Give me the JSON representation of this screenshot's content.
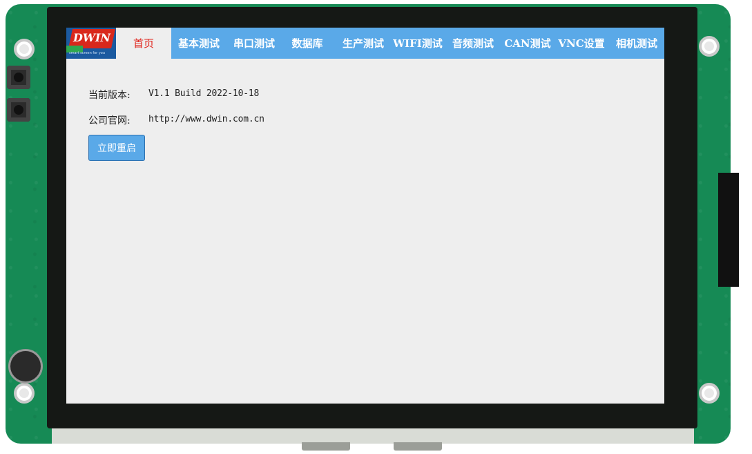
{
  "logo": {
    "text": "DWIN",
    "slogan": "smart screen for you"
  },
  "nav": {
    "tabs": [
      {
        "label": "首页"
      },
      {
        "label": "基本测试"
      },
      {
        "label": "串口测试"
      },
      {
        "label": "数据库"
      },
      {
        "label": "生产测试"
      },
      {
        "label": "WIFI测试"
      },
      {
        "label": "音频测试"
      },
      {
        "label": "CAN测试"
      },
      {
        "label": "VNC设置"
      },
      {
        "label": "相机测试"
      }
    ],
    "active_tab": "首页"
  },
  "home": {
    "version_label": "当前版本:",
    "version_value": "V1.1 Build 2022-10-18",
    "website_label": "公司官网:",
    "website_value": "http://www.dwin.com.cn",
    "restart_label": "立即重启"
  },
  "colors": {
    "nav_bg": "#5aa9e8",
    "active_tab_text": "#e0241c",
    "screen_bg": "#eeeeee",
    "board_pcb": "#168a55"
  }
}
